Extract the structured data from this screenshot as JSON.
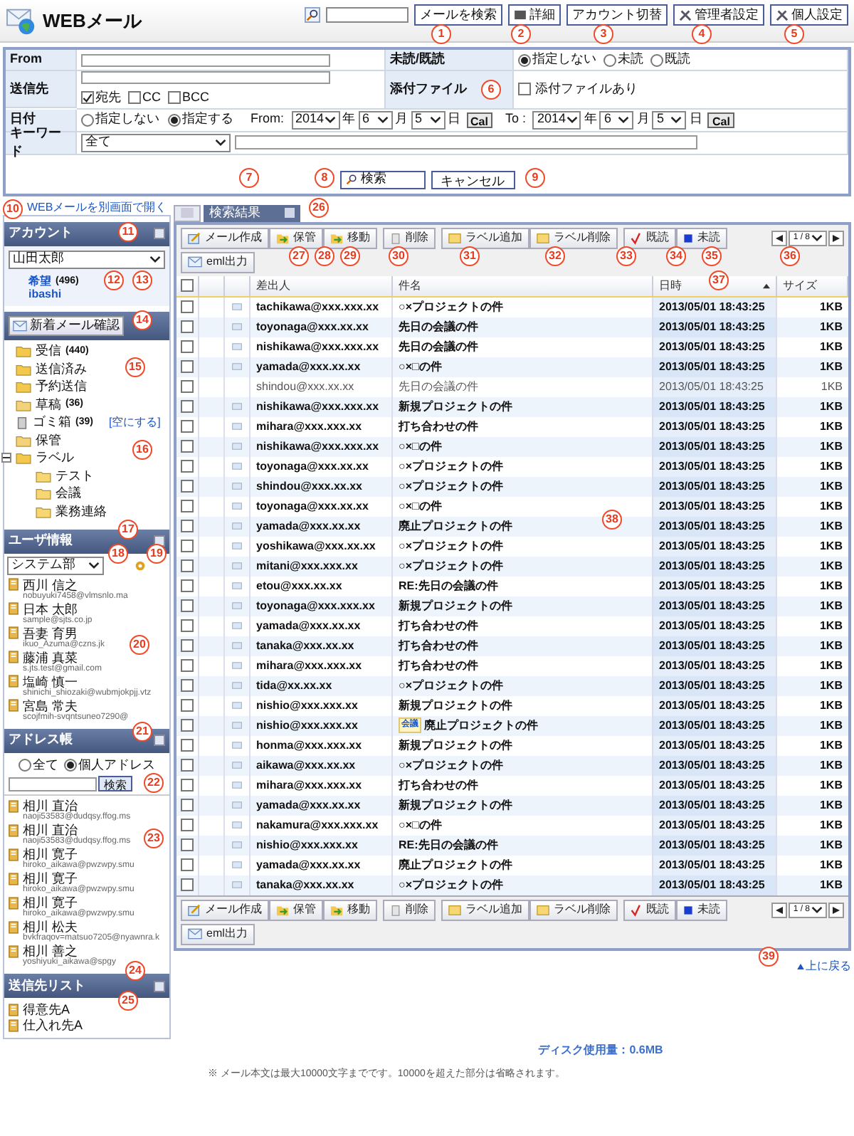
{
  "header": {
    "title": "WEBメール",
    "search_button": "メールを検索",
    "buttons": [
      {
        "kind": "detail",
        "label": "詳細"
      },
      {
        "kind": "account",
        "label": "アカウント切替"
      },
      {
        "kind": "admin",
        "label": "管理者設定"
      },
      {
        "kind": "personal",
        "label": "個人設定"
      }
    ]
  },
  "search_form": {
    "from_label": "From",
    "to_label": "送信先",
    "recipient_options": [
      {
        "label": "宛先",
        "checked": true
      },
      {
        "label": "CC",
        "checked": false
      },
      {
        "label": "BCC",
        "checked": false
      }
    ],
    "read_label": "未読/既読",
    "read_options": [
      {
        "label": "指定しない",
        "selected": true
      },
      {
        "label": "未読",
        "selected": false
      },
      {
        "label": "既読",
        "selected": false
      }
    ],
    "attachment_label": "添付ファイル",
    "attachment_option": {
      "label": "添付ファイルあり",
      "checked": false
    },
    "date_label": "日付",
    "date_options": [
      {
        "label": "指定しない",
        "selected": false
      },
      {
        "label": "指定する",
        "selected": true
      }
    ],
    "dates": [
      {
        "label": "From:",
        "year": "2014",
        "year_unit": "年",
        "month": "6",
        "month_unit": "月",
        "day": "5",
        "day_unit": "日",
        "cal": "Cal"
      },
      {
        "label": "To :",
        "year": "2014",
        "year_unit": "年",
        "month": "6",
        "month_unit": "月",
        "day": "5",
        "day_unit": "日",
        "cal": "Cal"
      }
    ],
    "keyword_label": "キーワード",
    "keyword_scope": "全て",
    "search": "検索",
    "cancel": "キャンセル"
  },
  "sidebar": {
    "open_link": "WEBメールを別画面で開く",
    "account": {
      "title": "アカウント",
      "selected_account": "山田太郎",
      "lines": [
        {
          "name": "希望",
          "count": "(496)"
        },
        {
          "name": "ibashi"
        }
      ],
      "check_button": "新着メール確認"
    },
    "folders": [
      {
        "name": "受信",
        "count": "(440)",
        "kind": "inbox"
      },
      {
        "name": "送信済み",
        "kind": "sent"
      },
      {
        "name": "予約送信",
        "kind": "scheduled"
      },
      {
        "name": "草稿",
        "count": "(36)",
        "kind": "folder"
      },
      {
        "name": "ゴミ箱",
        "count": "(39)",
        "kind": "trash",
        "action": "[空にする]"
      },
      {
        "name": "保管",
        "kind": "folder"
      },
      {
        "name": "ラベル",
        "kind": "labels",
        "expanded": true,
        "children": [
          {
            "name": "テスト",
            "kind": "label"
          },
          {
            "name": "会議",
            "kind": "label"
          },
          {
            "name": "業務連絡",
            "kind": "label"
          }
        ]
      }
    ],
    "users": {
      "title": "ユーザ情報",
      "group": "システム部",
      "items": [
        {
          "name": "西川 信之",
          "email": "nobuyuki7458@vlmsnlo.ma"
        },
        {
          "name": "日本 太郎",
          "email": "sample@sjts.co.jp"
        },
        {
          "name": "吾妻 育男",
          "email": "ikuo_Azuma@czns.jk"
        },
        {
          "name": "藤浦 真菜",
          "email": "s.jts.test@gmail.com"
        },
        {
          "name": "塩崎 慎一",
          "email": "shinichi_shiozaki@wubmjokpjj.vtz"
        },
        {
          "name": "宮島 常夫",
          "email": "scojfmih-svqntsuneo7290@"
        }
      ]
    },
    "address_book": {
      "title": "アドレス帳",
      "scopes": [
        {
          "label": "全て",
          "selected": false
        },
        {
          "label": "個人アドレス",
          "selected": true
        }
      ],
      "search_button": "検索",
      "items": [
        {
          "name": "相川 直治",
          "email": "naoji53583@dudqsy.ffog.ms"
        },
        {
          "name": "相川 直治",
          "email": "naoji53583@dudqsy.ffog.ms"
        },
        {
          "name": "相川 寛子",
          "email": "hiroko_aikawa@pwzwpy.smu"
        },
        {
          "name": "相川 寛子",
          "email": "hiroko_aikawa@pwzwpy.smu"
        },
        {
          "name": "相川 寛子",
          "email": "hiroko_aikawa@pwzwpy.smu"
        },
        {
          "name": "相川 松夫",
          "email": "bvkfraqov=matsuo7205@nyawnra.k"
        },
        {
          "name": "相川 善之",
          "email": "yoshiyuki_aikawa@spgy"
        }
      ]
    },
    "send_lists": {
      "title": "送信先リスト",
      "items": [
        "得意先A",
        "仕入れ先A"
      ]
    }
  },
  "tabs": [
    {
      "kind": "icon",
      "selected": false
    },
    {
      "kind": "text",
      "label": "検索結果",
      "selected": true
    }
  ],
  "toolbars": [
    {
      "tools": [
        {
          "kind": "compose",
          "label": "メール作成"
        },
        {
          "kind": "archive",
          "label": "保管"
        },
        {
          "kind": "move",
          "label": "移動"
        },
        {
          "kind": "delete",
          "label": "削除"
        },
        {
          "kind": "label_add",
          "label": "ラベル追加"
        },
        {
          "kind": "label_remove",
          "label": "ラベル削除"
        },
        {
          "kind": "read",
          "label": "既読"
        },
        {
          "kind": "unread",
          "label": "未読"
        },
        {
          "kind": "eml",
          "label": "eml出力"
        }
      ],
      "page": "1 / 8"
    },
    {
      "tools": [
        {
          "kind": "compose",
          "label": "メール作成"
        },
        {
          "kind": "archive",
          "label": "保管"
        },
        {
          "kind": "move",
          "label": "移動"
        },
        {
          "kind": "delete",
          "label": "削除"
        },
        {
          "kind": "label_add",
          "label": "ラベル追加"
        },
        {
          "kind": "label_remove",
          "label": "ラベル削除"
        },
        {
          "kind": "read",
          "label": "既読"
        },
        {
          "kind": "unread",
          "label": "未読"
        },
        {
          "kind": "eml",
          "label": "eml出力"
        }
      ],
      "page": "1 / 8"
    }
  ],
  "table": {
    "select_all": false,
    "columns": [
      {
        "label": "差出人"
      },
      {
        "label": "件名"
      },
      {
        "label": "日時",
        "sorted": true
      },
      {
        "label": "サイズ"
      }
    ],
    "rows": [
      {
        "sender": "tachikawa@xxx.xxx.xx",
        "subject": "○×プロジェクトの件",
        "date": "2013/05/01 18:43:25",
        "size": "1KB",
        "unread": true,
        "checked": false
      },
      {
        "sender": "toyonaga@xxx.xx.xx",
        "subject": "先日の会議の件",
        "date": "2013/05/01 18:43:25",
        "size": "1KB",
        "unread": true,
        "checked": false
      },
      {
        "sender": "nishikawa@xxx.xxx.xx",
        "subject": "先日の会議の件",
        "date": "2013/05/01 18:43:25",
        "size": "1KB",
        "unread": true,
        "checked": false
      },
      {
        "sender": "yamada@xxx.xx.xx",
        "subject": "○×□の件",
        "date": "2013/05/01 18:43:25",
        "size": "1KB",
        "unread": true,
        "checked": false
      },
      {
        "sender": "shindou@xxx.xx.xx",
        "subject": "先日の会議の件",
        "date": "2013/05/01 18:43:25",
        "size": "1KB",
        "unread": false,
        "checked": false
      },
      {
        "sender": "nishikawa@xxx.xxx.xx",
        "subject": "新規プロジェクトの件",
        "date": "2013/05/01 18:43:25",
        "size": "1KB",
        "unread": true,
        "checked": false
      },
      {
        "sender": "mihara@xxx.xxx.xx",
        "subject": "打ち合わせの件",
        "date": "2013/05/01 18:43:25",
        "size": "1KB",
        "unread": true,
        "checked": false
      },
      {
        "sender": "nishikawa@xxx.xxx.xx",
        "subject": "○×□の件",
        "date": "2013/05/01 18:43:25",
        "size": "1KB",
        "unread": true,
        "checked": false
      },
      {
        "sender": "toyonaga@xxx.xx.xx",
        "subject": "○×プロジェクトの件",
        "date": "2013/05/01 18:43:25",
        "size": "1KB",
        "unread": true,
        "checked": false
      },
      {
        "sender": "shindou@xxx.xx.xx",
        "subject": "○×プロジェクトの件",
        "date": "2013/05/01 18:43:25",
        "size": "1KB",
        "unread": true,
        "checked": false
      },
      {
        "sender": "toyonaga@xxx.xx.xx",
        "subject": "○×□の件",
        "date": "2013/05/01 18:43:25",
        "size": "1KB",
        "unread": true,
        "checked": false
      },
      {
        "sender": "yamada@xxx.xx.xx",
        "subject": "廃止プロジェクトの件",
        "date": "2013/05/01 18:43:25",
        "size": "1KB",
        "unread": true,
        "checked": false
      },
      {
        "sender": "yoshikawa@xxx.xx.xx",
        "subject": "○×プロジェクトの件",
        "date": "2013/05/01 18:43:25",
        "size": "1KB",
        "unread": true,
        "checked": false
      },
      {
        "sender": "mitani@xxx.xxx.xx",
        "subject": "○×プロジェクトの件",
        "date": "2013/05/01 18:43:25",
        "size": "1KB",
        "unread": true,
        "checked": false
      },
      {
        "sender": "etou@xxx.xx.xx",
        "subject": "RE:先日の会議の件",
        "date": "2013/05/01 18:43:25",
        "size": "1KB",
        "unread": true,
        "checked": false
      },
      {
        "sender": "toyonaga@xxx.xxx.xx",
        "subject": "新規プロジェクトの件",
        "date": "2013/05/01 18:43:25",
        "size": "1KB",
        "unread": true,
        "checked": false
      },
      {
        "sender": "yamada@xxx.xx.xx",
        "subject": "打ち合わせの件",
        "date": "2013/05/01 18:43:25",
        "size": "1KB",
        "unread": true,
        "checked": false
      },
      {
        "sender": "tanaka@xxx.xx.xx",
        "subject": "打ち合わせの件",
        "date": "2013/05/01 18:43:25",
        "size": "1KB",
        "unread": true,
        "checked": false
      },
      {
        "sender": "mihara@xxx.xxx.xx",
        "subject": "打ち合わせの件",
        "date": "2013/05/01 18:43:25",
        "size": "1KB",
        "unread": true,
        "checked": false
      },
      {
        "sender": "tida@xx.xx.xx",
        "subject": "○×プロジェクトの件",
        "date": "2013/05/01 18:43:25",
        "size": "1KB",
        "unread": true,
        "checked": false
      },
      {
        "sender": "nishio@xxx.xxx.xx",
        "subject": "新規プロジェクトの件",
        "date": "2013/05/01 18:43:25",
        "size": "1KB",
        "unread": true,
        "checked": false
      },
      {
        "sender": "nishio@xxx.xxx.xx",
        "label": "会議",
        "subject": "廃止プロジェクトの件",
        "date": "2013/05/01 18:43:25",
        "size": "1KB",
        "unread": true,
        "checked": false
      },
      {
        "sender": "honma@xxx.xxx.xx",
        "subject": "新規プロジェクトの件",
        "date": "2013/05/01 18:43:25",
        "size": "1KB",
        "unread": true,
        "checked": false
      },
      {
        "sender": "aikawa@xxx.xx.xx",
        "subject": "○×プロジェクトの件",
        "date": "2013/05/01 18:43:25",
        "size": "1KB",
        "unread": true,
        "checked": false
      },
      {
        "sender": "mihara@xxx.xxx.xx",
        "subject": "打ち合わせの件",
        "date": "2013/05/01 18:43:25",
        "size": "1KB",
        "unread": true,
        "checked": false
      },
      {
        "sender": "yamada@xxx.xx.xx",
        "subject": "新規プロジェクトの件",
        "date": "2013/05/01 18:43:25",
        "size": "1KB",
        "unread": true,
        "checked": false
      },
      {
        "sender": "nakamura@xxx.xxx.xx",
        "subject": "○×□の件",
        "date": "2013/05/01 18:43:25",
        "size": "1KB",
        "unread": true,
        "checked": false
      },
      {
        "sender": "nishio@xxx.xxx.xx",
        "subject": "RE:先日の会議の件",
        "date": "2013/05/01 18:43:25",
        "size": "1KB",
        "unread": true,
        "checked": false
      },
      {
        "sender": "yamada@xxx.xx.xx",
        "subject": "廃止プロジェクトの件",
        "date": "2013/05/01 18:43:25",
        "size": "1KB",
        "unread": true,
        "checked": false
      },
      {
        "sender": "tanaka@xxx.xx.xx",
        "subject": "○×プロジェクトの件",
        "date": "2013/05/01 18:43:25",
        "size": "1KB",
        "unread": true,
        "checked": false
      }
    ]
  },
  "back_to_top": "上に戻る",
  "disk_usage": "ディスク使用量：0.6MB",
  "note": "※ メール本文は最大10000文字までです。10000を超えた部分は省略されます。",
  "markers": [
    "1",
    "2",
    "3",
    "4",
    "5",
    "6",
    "7",
    "8",
    "9",
    "10",
    "11",
    "12",
    "13",
    "14",
    "15",
    "16",
    "17",
    "18",
    "19",
    "20",
    "21",
    "22",
    "23",
    "24",
    "25",
    "26",
    "27",
    "28",
    "29",
    "30",
    "31",
    "32",
    "33",
    "34",
    "35",
    "36",
    "37",
    "38",
    "39"
  ]
}
